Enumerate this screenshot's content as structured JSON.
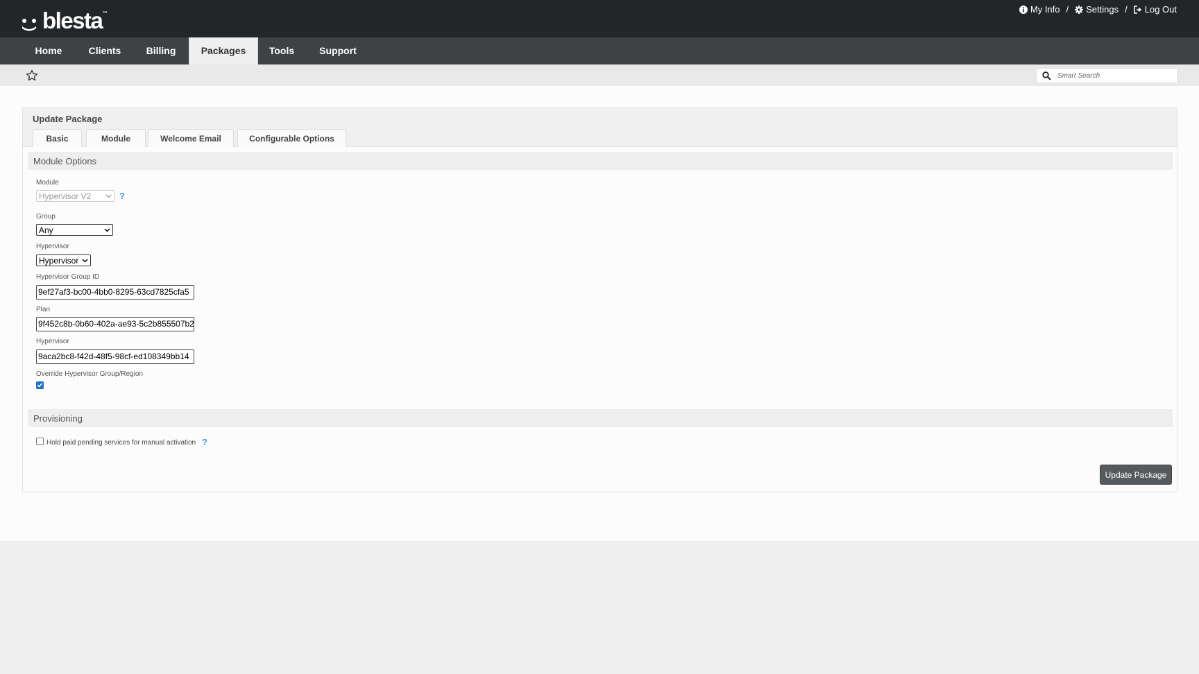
{
  "app": {
    "logo_text": "blesta",
    "logo_tm": "™"
  },
  "header": {
    "links": [
      {
        "label": "My Info",
        "icon": "info-circle-icon"
      },
      {
        "label": "Settings",
        "icon": "gear-icon"
      },
      {
        "label": "Log Out",
        "icon": "sign-out-icon"
      }
    ],
    "separator": "/"
  },
  "nav": {
    "items": [
      {
        "label": "Home"
      },
      {
        "label": "Clients"
      },
      {
        "label": "Billing"
      },
      {
        "label": "Packages",
        "active": true
      },
      {
        "label": "Tools"
      },
      {
        "label": "Support"
      }
    ]
  },
  "search": {
    "placeholder": "Smart Search"
  },
  "panel": {
    "title": "Update Package",
    "tabs": [
      {
        "label": "Basic"
      },
      {
        "label": "Module"
      },
      {
        "label": "Welcome Email"
      },
      {
        "label": "Configurable Options"
      }
    ]
  },
  "module_options": {
    "title": "Module Options",
    "module_label": "Module",
    "module_value": "Hypervisor V2",
    "help_glyph": "?",
    "group_label": "Group",
    "group_value": "Any",
    "hypervisor_select_label": "Hypervisor",
    "hypervisor_select_value": "Hypervisor",
    "group_id_label": "Hypervisor Group ID",
    "group_id_value": "9ef27af3-bc00-4bb0-8295-63cd7825cfa5",
    "plan_label": "Plan",
    "plan_value": "9f452c8b-0b60-402a-ae93-5c2b855507b2",
    "hypervisor_text_label": "Hypervisor",
    "hypervisor_text_value": "9aca2bc8-f42d-48f5-98cf-ed108349bb14",
    "override_label": "Override Hypervisor Group/Region",
    "override_checked": true
  },
  "provisioning": {
    "title": "Provisioning",
    "hold_label": "Hold paid pending services for manual activation",
    "hold_checked": false
  },
  "actions": {
    "submit_label": "Update Package"
  },
  "colors": {
    "topbar": "#232628",
    "navbar": "#3e4245",
    "accent_link": "#3b9ae0",
    "button": "#555a5e",
    "checkbox": "#1a73c8"
  }
}
